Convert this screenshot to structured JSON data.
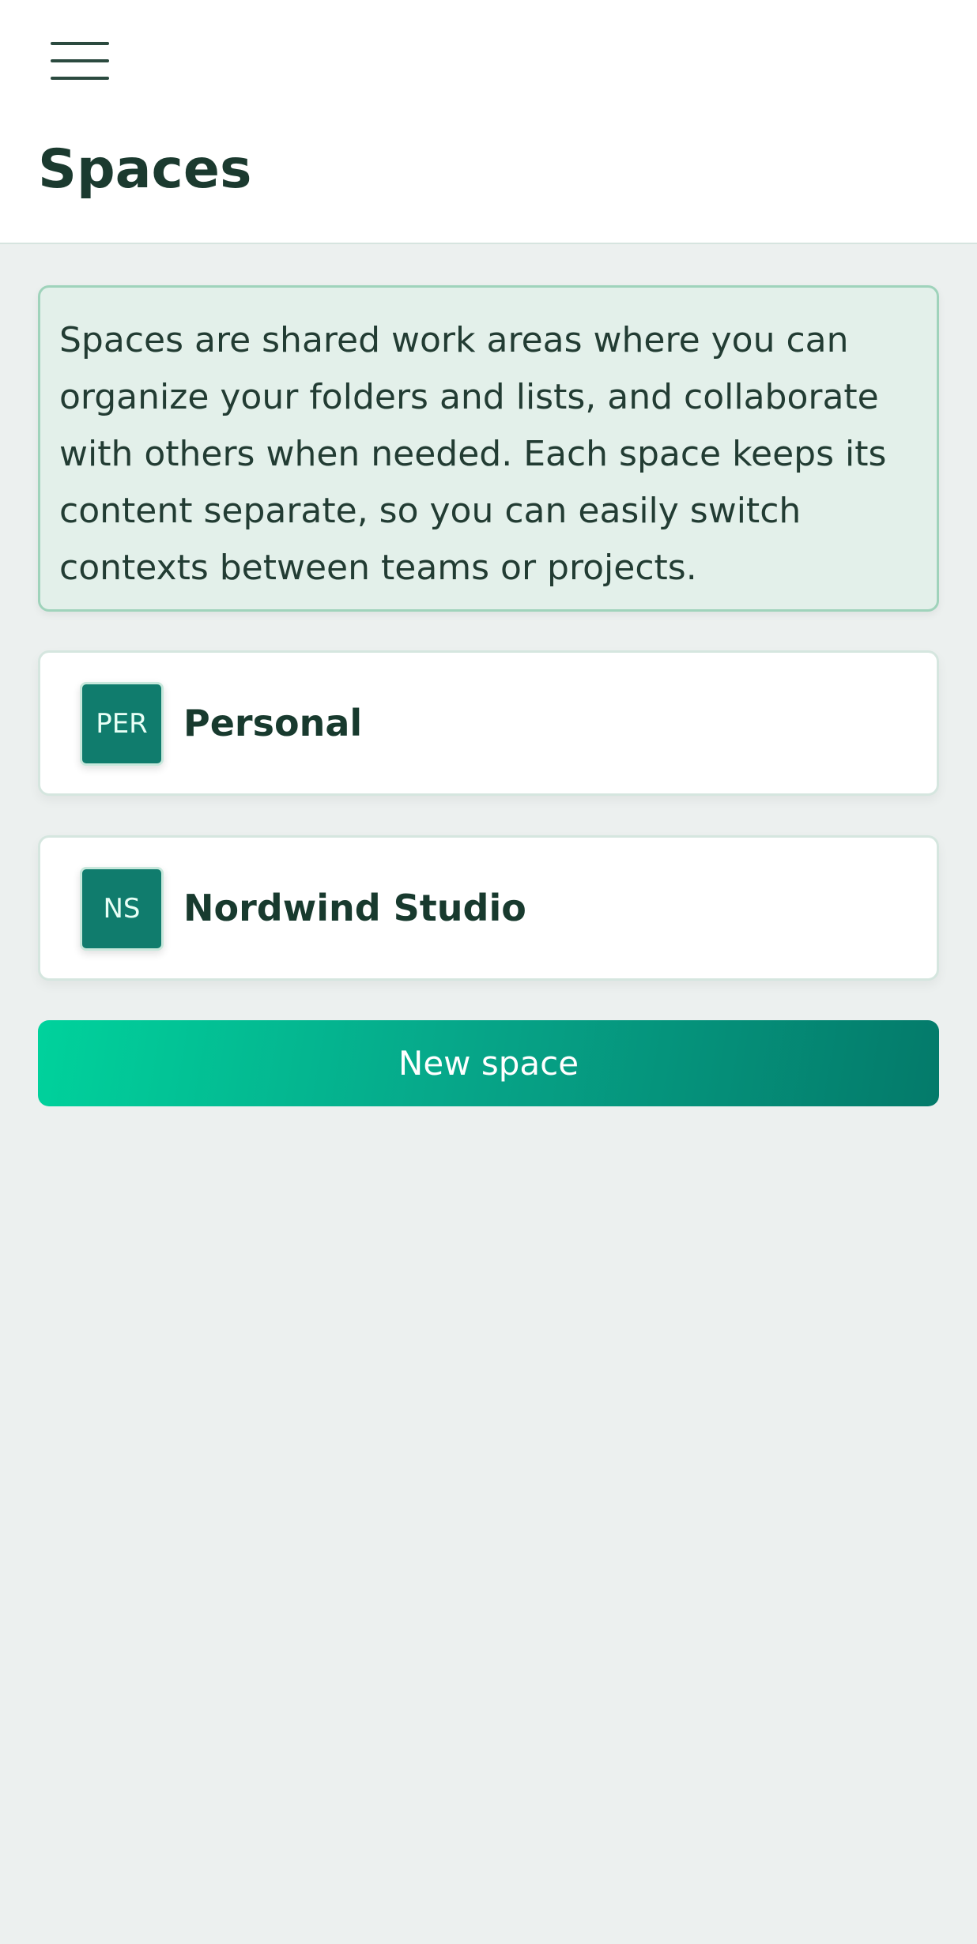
{
  "header": {
    "menu_icon": "hamburger-menu-icon",
    "title": "Spaces"
  },
  "info": {
    "text": "Spaces are shared work areas where you can organize your folders and lists, and collaborate with others when needed. Each space keeps its content separate, so you can easily switch contexts between teams or projects."
  },
  "spaces": [
    {
      "initials": "PER",
      "name": "Personal"
    },
    {
      "initials": "NS",
      "name": "Nordwind Studio"
    }
  ],
  "actions": {
    "new_space_label": "New space"
  },
  "colors": {
    "accent": "#107c6d",
    "gradient_start": "#00d29c",
    "gradient_end": "#047a6a",
    "info_background": "#e3f0ea",
    "page_background": "#ecf0ef"
  }
}
